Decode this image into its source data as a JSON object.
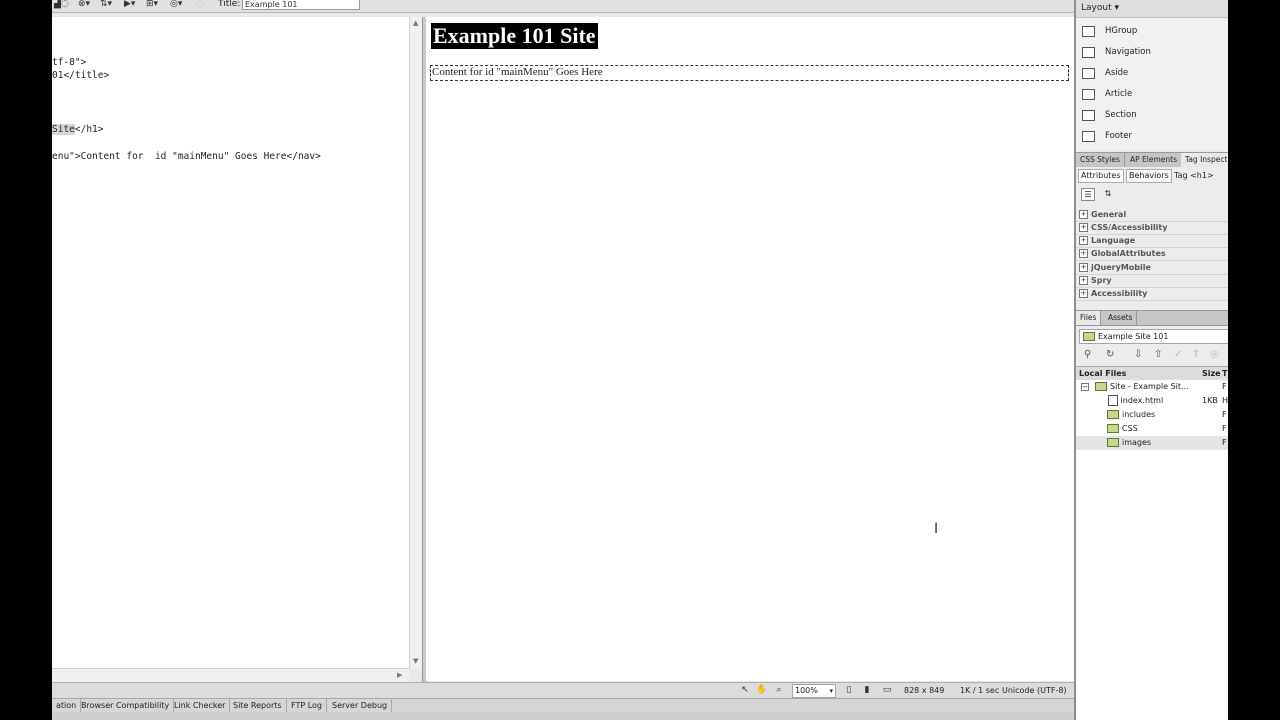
{
  "toolbar": {
    "title_label": "Title:",
    "title_value": "Example 101"
  },
  "code_lines": [
    "tf-8\">",
    "01</title>",
    "Site",
    "</h1>",
    "enu\">Content for  id \"mainMenu\" Goes Here</nav>"
  ],
  "design": {
    "heading": "Example 101 Site",
    "nav_content": "Content for id \"mainMenu\" Goes Here"
  },
  "status_bar": {
    "zoom": "100%",
    "dimensions": "828 x 849",
    "download": "1K / 1 sec",
    "encoding": "Unicode (UTF-8)"
  },
  "bottom_tabs": [
    "ation",
    "Browser Compatibility",
    "Link Checker",
    "Site Reports",
    "FTP Log",
    "Server Debug"
  ],
  "layout_panel": {
    "title": "Layout",
    "items": [
      {
        "label": "HGroup",
        "icon": "hgroup-icon"
      },
      {
        "label": "Navigation",
        "icon": "navigation-icon"
      },
      {
        "label": "Aside",
        "icon": "aside-icon"
      },
      {
        "label": "Article",
        "icon": "article-icon"
      },
      {
        "label": "Section",
        "icon": "section-icon"
      },
      {
        "label": "Footer",
        "icon": "footer-icon"
      }
    ]
  },
  "inspector": {
    "tabs": [
      "CSS Styles",
      "AP Elements",
      "Tag Inspect"
    ],
    "attributes_label": "Attributes",
    "behaviors_label": "Behaviors",
    "tag_label": "Tag <h1>",
    "categories": [
      "General",
      "CSS/Accessibility",
      "Language",
      "GlobalAttributes",
      "jQueryMobile",
      "Spry",
      "Accessibility"
    ]
  },
  "files": {
    "tabs": [
      "Files",
      "Assets"
    ],
    "site_name": "Example Site 101",
    "header_local": "Local Files",
    "header_size": "Size",
    "header_type": "T",
    "tree": [
      {
        "name": "Site - Example Sit...",
        "size": "",
        "type": "F"
      },
      {
        "name": "index.html",
        "size": "1KB",
        "type": "H"
      },
      {
        "name": "includes",
        "size": "",
        "type": "F"
      },
      {
        "name": "CSS",
        "size": "",
        "type": "F"
      },
      {
        "name": "images",
        "size": "",
        "type": "F"
      }
    ]
  },
  "colors": {
    "heading_bg": "#000000",
    "heading_text": "#ffffff",
    "panel_bg": "#ececec",
    "folder": "#c9d58d"
  }
}
